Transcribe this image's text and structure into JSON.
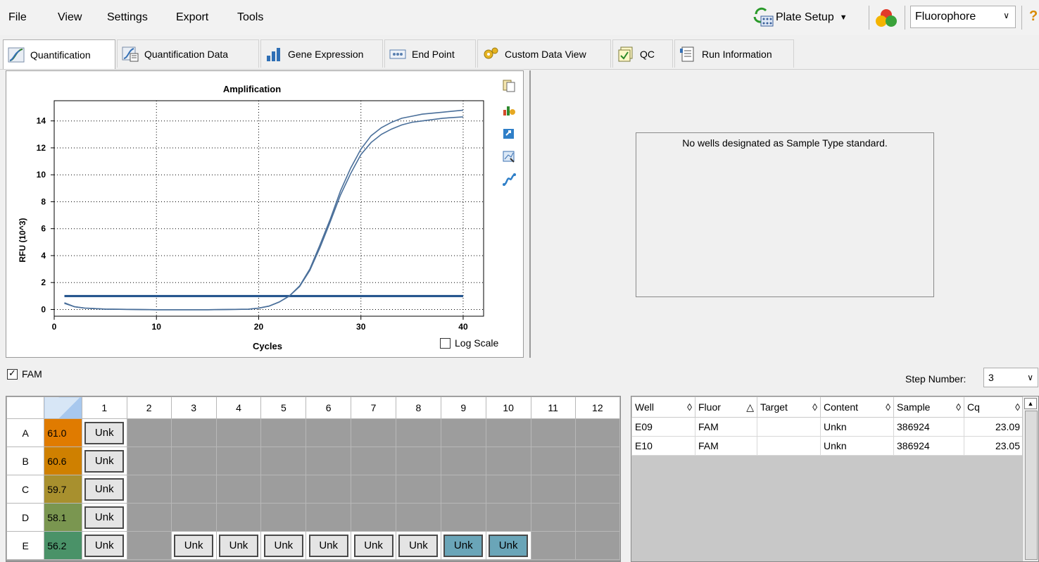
{
  "menu": {
    "items": [
      "File",
      "View",
      "Settings",
      "Export",
      "Tools"
    ]
  },
  "toolbar": {
    "plate_setup_label": "Plate Setup",
    "fluor_selected": "Fluorophore",
    "help_label": "?"
  },
  "tabs": [
    {
      "label": "Quantification",
      "active": true
    },
    {
      "label": "Quantification Data"
    },
    {
      "label": "Gene Expression"
    },
    {
      "label": "End Point"
    },
    {
      "label": "Custom Data View"
    },
    {
      "label": "QC"
    },
    {
      "label": "Run Information"
    }
  ],
  "chart_data": {
    "type": "line",
    "title": "Amplification",
    "xlabel": "Cycles",
    "ylabel": "RFU (10^3)",
    "xlim": [
      0,
      42
    ],
    "ylim": [
      -0.5,
      15.5
    ],
    "xticks": [
      0,
      10,
      20,
      30,
      40
    ],
    "yticks": [
      0,
      2,
      4,
      6,
      8,
      10,
      12,
      14
    ],
    "grid": true,
    "threshold": 1.0,
    "series": [
      {
        "values": [
          [
            1,
            0.5
          ],
          [
            2,
            0.2
          ],
          [
            3,
            0.1
          ],
          [
            5,
            0.03
          ],
          [
            10,
            -0.02
          ],
          [
            15,
            -0.02
          ],
          [
            19,
            0.02
          ],
          [
            20,
            0.1
          ],
          [
            21,
            0.25
          ],
          [
            22,
            0.55
          ],
          [
            23,
            1.0
          ],
          [
            24,
            1.7
          ],
          [
            25,
            2.9
          ],
          [
            26,
            4.6
          ],
          [
            27,
            6.5
          ],
          [
            28,
            8.5
          ],
          [
            29,
            10.1
          ],
          [
            30,
            11.5
          ],
          [
            31,
            12.4
          ],
          [
            32,
            13.0
          ],
          [
            33,
            13.4
          ],
          [
            34,
            13.7
          ],
          [
            35,
            13.9
          ],
          [
            36,
            14.0
          ],
          [
            38,
            14.2
          ],
          [
            40,
            14.3
          ]
        ]
      },
      {
        "values": [
          [
            1,
            0.45
          ],
          [
            2,
            0.2
          ],
          [
            3,
            0.1
          ],
          [
            5,
            0.03
          ],
          [
            10,
            -0.02
          ],
          [
            15,
            -0.02
          ],
          [
            19,
            0.02
          ],
          [
            20,
            0.1
          ],
          [
            21,
            0.25
          ],
          [
            22,
            0.55
          ],
          [
            23,
            1.0
          ],
          [
            24,
            1.75
          ],
          [
            25,
            3.0
          ],
          [
            26,
            4.8
          ],
          [
            27,
            6.7
          ],
          [
            28,
            8.8
          ],
          [
            29,
            10.5
          ],
          [
            30,
            11.9
          ],
          [
            31,
            12.9
          ],
          [
            32,
            13.5
          ],
          [
            33,
            13.9
          ],
          [
            34,
            14.2
          ],
          [
            35,
            14.35
          ],
          [
            36,
            14.5
          ],
          [
            38,
            14.65
          ],
          [
            40,
            14.8
          ]
        ]
      }
    ]
  },
  "log_scale": {
    "label": "Log Scale",
    "checked": false
  },
  "standard_message": "No wells designated as Sample Type standard.",
  "fam": {
    "label": "FAM",
    "checked": true
  },
  "step": {
    "label": "Step Number:",
    "value": "3"
  },
  "plate": {
    "columns": [
      "1",
      "2",
      "3",
      "4",
      "5",
      "6",
      "7",
      "8",
      "9",
      "10",
      "11",
      "12"
    ],
    "rows": [
      {
        "label": "A",
        "temp": "61.0",
        "color": "#e07b00",
        "cells": [
          "Unk",
          "",
          "",
          "",
          "",
          "",
          "",
          "",
          "",
          "",
          "",
          ""
        ]
      },
      {
        "label": "B",
        "temp": "60.6",
        "color": "#cf8000",
        "cells": [
          "Unk",
          "",
          "",
          "",
          "",
          "",
          "",
          "",
          "",
          "",
          "",
          ""
        ]
      },
      {
        "label": "C",
        "temp": "59.7",
        "color": "#a8902e",
        "cells": [
          "Unk",
          "",
          "",
          "",
          "",
          "",
          "",
          "",
          "",
          "",
          "",
          ""
        ]
      },
      {
        "label": "D",
        "temp": "58.1",
        "color": "#7a9650",
        "cells": [
          "Unk",
          "",
          "",
          "",
          "",
          "",
          "",
          "",
          "",
          "",
          "",
          ""
        ]
      },
      {
        "label": "E",
        "temp": "56.2",
        "color": "#4a9268",
        "cells": [
          "Unk",
          "",
          "Unk",
          "Unk",
          "Unk",
          "Unk",
          "Unk",
          "Unk",
          "Unk",
          "Unk",
          "",
          ""
        ]
      }
    ],
    "selected_wells": [
      "E9",
      "E10"
    ]
  },
  "results": {
    "headers": [
      "Well",
      "Fluor",
      "Target",
      "Content",
      "Sample",
      "Cq"
    ],
    "rows": [
      [
        "E09",
        "FAM",
        "",
        "Unkn",
        "386924",
        "23.09"
      ],
      [
        "E10",
        "FAM",
        "",
        "Unkn",
        "386924",
        "23.05"
      ]
    ]
  }
}
